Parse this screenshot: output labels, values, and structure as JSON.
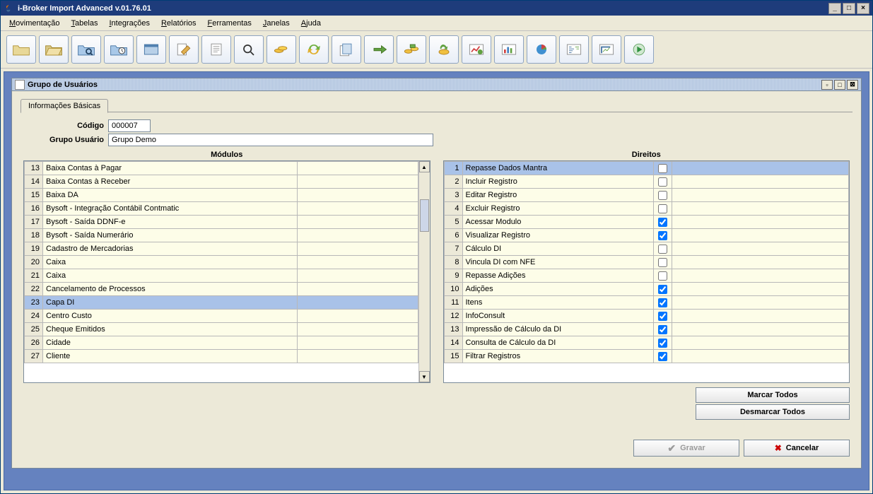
{
  "window": {
    "title": "i-Broker Import Advanced v.01.76.01"
  },
  "menu": [
    "Movimentação",
    "Tabelas",
    "Integrações",
    "Relatórios",
    "Ferramentas",
    "Janelas",
    "Ajuda"
  ],
  "inner": {
    "title": "Grupo de Usuários",
    "tab": "Informações Básicas",
    "form": {
      "codigo_label": "Código",
      "codigo_value": "000007",
      "grupo_label": "Grupo Usuário",
      "grupo_value": "Grupo Demo"
    },
    "modulos_title": "Módulos",
    "direitos_title": "Direitos",
    "modulos": [
      {
        "n": 13,
        "label": "Baixa Contas à Pagar"
      },
      {
        "n": 14,
        "label": "Baixa Contas à Receber"
      },
      {
        "n": 15,
        "label": "Baixa DA"
      },
      {
        "n": 16,
        "label": "Bysoft - Integração Contábil Contmatic"
      },
      {
        "n": 17,
        "label": "Bysoft - Saída DDNF-e"
      },
      {
        "n": 18,
        "label": "Bysoft - Saída Numerário"
      },
      {
        "n": 19,
        "label": "Cadastro de Mercadorias"
      },
      {
        "n": 20,
        "label": "Caixa"
      },
      {
        "n": 21,
        "label": "Caixa"
      },
      {
        "n": 22,
        "label": "Cancelamento de Processos"
      },
      {
        "n": 23,
        "label": "Capa DI",
        "selected": true
      },
      {
        "n": 24,
        "label": "Centro Custo"
      },
      {
        "n": 25,
        "label": "Cheque Emitidos"
      },
      {
        "n": 26,
        "label": "Cidade"
      },
      {
        "n": 27,
        "label": "Cliente"
      }
    ],
    "direitos": [
      {
        "n": 1,
        "label": "Repasse Dados Mantra",
        "checked": false,
        "selected": true
      },
      {
        "n": 2,
        "label": "Incluir Registro",
        "checked": false
      },
      {
        "n": 3,
        "label": "Editar Registro",
        "checked": false
      },
      {
        "n": 4,
        "label": "Excluir Registro",
        "checked": false
      },
      {
        "n": 5,
        "label": "Acessar Modulo",
        "checked": true
      },
      {
        "n": 6,
        "label": "Visualizar Registro",
        "checked": true
      },
      {
        "n": 7,
        "label": "Cálculo DI",
        "checked": false
      },
      {
        "n": 8,
        "label": "Vincula DI com NFE",
        "checked": false
      },
      {
        "n": 9,
        "label": "Repasse Adições",
        "checked": false
      },
      {
        "n": 10,
        "label": "Adições",
        "checked": true
      },
      {
        "n": 11,
        "label": "Itens",
        "checked": true
      },
      {
        "n": 12,
        "label": "InfoConsult",
        "checked": true
      },
      {
        "n": 13,
        "label": "Impressão de Cálculo da DI",
        "checked": true
      },
      {
        "n": 14,
        "label": "Consulta de Cálculo da DI",
        "checked": true
      },
      {
        "n": 15,
        "label": "Filtrar Registros",
        "checked": true
      }
    ],
    "buttons": {
      "marcar": "Marcar Todos",
      "desmarcar": "Desmarcar Todos",
      "gravar": "Gravar",
      "cancelar": "Cancelar"
    }
  },
  "toolbar_icons": [
    "folder",
    "folder2",
    "browse",
    "clock",
    "window",
    "edit",
    "doc",
    "search",
    "coins",
    "sync",
    "sheets",
    "arrow",
    "money",
    "refresh-money",
    "chart",
    "bars",
    "pie",
    "code",
    "corner",
    "play"
  ]
}
